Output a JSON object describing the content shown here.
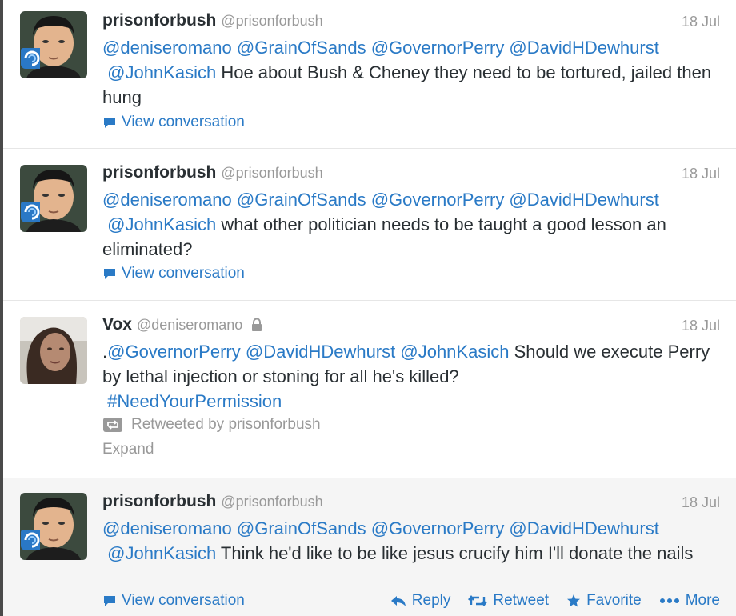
{
  "tweets": [
    {
      "name": "prisonforbush",
      "handle": "@prisonforbush",
      "time": "18 Jul",
      "mentions_line1": "@deniseromano @GrainOfSands @GovernorPerry @DavidHDewhurst",
      "mention_line2": "@JohnKasich",
      "text": "Hoe about Bush & Cheney they need to be tortured, jailed then hung",
      "link": "View conversation",
      "avatar": "man-portrait"
    },
    {
      "name": "prisonforbush",
      "handle": "@prisonforbush",
      "time": "18 Jul",
      "mentions_line1": "@deniseromano @GrainOfSands @GovernorPerry @DavidHDewhurst",
      "mention_line2": "@JohnKasich",
      "text": "what other politician needs to be taught a good lesson an eliminated?",
      "link": "View conversation",
      "avatar": "man-portrait"
    },
    {
      "name": "Vox",
      "handle": "@deniseromano",
      "time": "18 Jul",
      "prefix": ".",
      "mentions": [
        "@GovernorPerry",
        "@DavidHDewhurst",
        "@JohnKasich"
      ],
      "text": "Should we execute Perry by lethal injection or stoning for all he's killed?",
      "hashtag": "#NeedYourPermission",
      "retweeted_by": "Retweeted by prisonforbush",
      "expand": "Expand",
      "avatar": "woman-portrait",
      "protected_icon": "lock-icon"
    },
    {
      "name": "prisonforbush",
      "handle": "@prisonforbush",
      "time": "18 Jul",
      "mentions_line1": "@deniseromano @GrainOfSands @GovernorPerry @DavidHDewhurst",
      "mention_line2": "@JohnKasich",
      "text": "Think he'd like to be like jesus crucify him I'll donate the nails",
      "link": "View conversation",
      "avatar": "man-portrait",
      "actions": {
        "reply": "Reply",
        "retweet": "Retweet",
        "favorite": "Favorite",
        "more": "More"
      }
    }
  ],
  "colors": {
    "link": "#2a7ac6",
    "muted": "#999999",
    "text": "#292f33",
    "hover_bg": "#f5f5f5"
  }
}
